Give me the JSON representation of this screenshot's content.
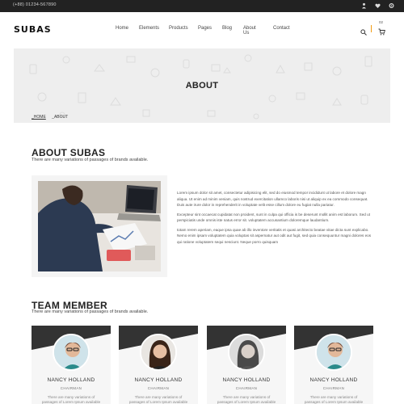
{
  "topbar": {
    "phone": "(+88) 01234-567890"
  },
  "header": {
    "logo": "SUBAS",
    "nav": [
      "Home",
      "Elements",
      "Products",
      "Pages",
      "Blog",
      "About Us",
      "Contact"
    ],
    "cart_count": "02"
  },
  "banner": {
    "title": "ABOUT",
    "breadcrumb": [
      "_HOME",
      "_ABOUT"
    ]
  },
  "about": {
    "title": "ABOUT SUBAS",
    "subtitle": "There are many variations of passages of brands available.",
    "paragraphs": [
      "Lorem ipsum dolor sit amet, consectetur adipisicing elit, sed do eiusmod tempor incididunt ut labore et dolore magn aliqua. Ut enim ad minim veniam, quis nostrud exercitation ullamco laboris nisi ut aliquip ex ea commodo consequat. Duis aute irure dolor in reprehenderit in voluptate velit esse cillum dolore eu fugiat nulla pariatur.",
      "Excepteur sint occaecat cupidatat non proident, sunt in culpa qui officia is be deserunt mollit anim est laborum. Sed ut perspiciatis unde omnis iste natus error sit. voluptatem accusantium doloremque laudantium.",
      "totam rerem aperiam, eaque ipsa quae ab illo inventore veritatis et quasi architecto beatae vitae dicta sunt explicabo. Nemo enim ipsam voluptatem quia voluptas sit aspernatur aut odit aut fugit, sed quia consequuntur magni dolores eos qui ratione voluptatem sequi nesciunt. Neque porro quisquam"
    ]
  },
  "team": {
    "title": "TEAM MEMBER",
    "subtitle": "There are many variations of passages of brands available.",
    "members": [
      {
        "name": "NANCY HOLLAND",
        "role": "CHAIRMAN",
        "desc": "There are many variations of passages of Lorem Ipsum available"
      },
      {
        "name": "NANCY HOLLAND",
        "role": "CHAIRMAN",
        "desc": "There are many variations of passages of Lorem Ipsum available"
      },
      {
        "name": "NANCY HOLLAND",
        "role": "CHAIRMAN",
        "desc": "There are many variations of passages of Lorem Ipsum available"
      },
      {
        "name": "NANCY HOLLAND",
        "role": "CHAIRMAN",
        "desc": "There are many variations of passages of Lorem Ipsum available"
      }
    ]
  },
  "icons": {
    "user": "user-icon",
    "heart": "heart-icon",
    "settings": "gear-icon",
    "search": "search-icon",
    "cart": "cart-icon"
  },
  "colors": {
    "topbar": "#222222",
    "accent": "#f39c12",
    "banner_bg": "#eeeeee",
    "card_dark": "#333333"
  }
}
